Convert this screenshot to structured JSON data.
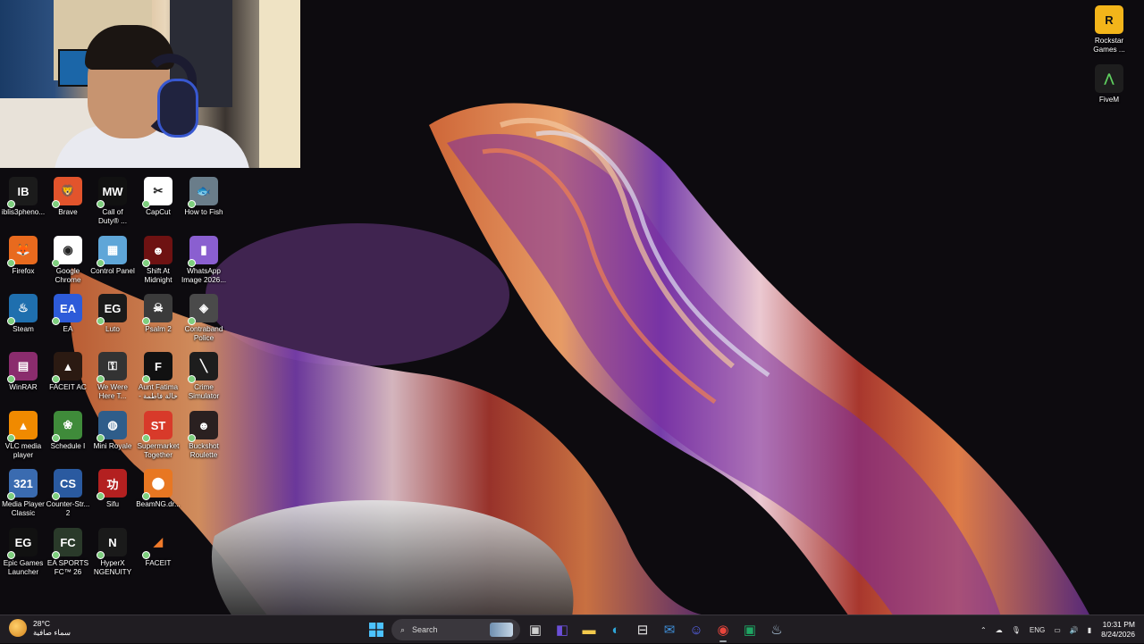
{
  "desktop": {
    "icons": [
      {
        "label": "iblis3pheno...",
        "icon": "iblis-icon",
        "color": "#1b1b1b",
        "glyph": "IB"
      },
      {
        "label": "Brave",
        "icon": "brave-icon",
        "color": "#e2542c",
        "glyph": "🦁"
      },
      {
        "label": "Call of\nDuty® ...",
        "icon": "call-of-duty-icon",
        "color": "#111111",
        "glyph": "MW"
      },
      {
        "label": "CapCut",
        "icon": "capcut-icon",
        "color": "#ffffff",
        "glyph": "✂"
      },
      {
        "label": "How to Fish",
        "icon": "how-to-fish-icon",
        "color": "#6a7d8a",
        "glyph": "🐟"
      },
      {
        "label": "Firefox",
        "icon": "firefox-icon",
        "color": "#e86a1e",
        "glyph": "🦊"
      },
      {
        "label": "Google\nChrome",
        "icon": "chrome-icon",
        "color": "#ffffff",
        "glyph": "◉"
      },
      {
        "label": "Control Panel",
        "icon": "control-panel-icon",
        "color": "#5fa6d8",
        "glyph": "▦"
      },
      {
        "label": "Shift At\nMidnight",
        "icon": "shift-at-midnight-icon",
        "color": "#6e1212",
        "glyph": "☻"
      },
      {
        "label": "WhatsApp\nImage 2026...",
        "icon": "image-file-icon",
        "color": "#8a5fd0",
        "glyph": "▮"
      },
      {
        "label": "Steam",
        "icon": "steam-icon",
        "color": "#1f6fae",
        "glyph": "♨"
      },
      {
        "label": "EA",
        "icon": "ea-icon",
        "color": "#2d5bd9",
        "glyph": "EA"
      },
      {
        "label": "Luto",
        "icon": "epic-games-icon",
        "color": "#1a1a1a",
        "glyph": "EG"
      },
      {
        "label": "Psalm 2",
        "icon": "psalm-2-icon",
        "color": "#3b3b3b",
        "glyph": "☠"
      },
      {
        "label": "Contraband\nPolice",
        "icon": "contraband-police-icon",
        "color": "#4a4a4a",
        "glyph": "◈"
      },
      {
        "label": "WinRAR",
        "icon": "winrar-icon",
        "color": "#8a2c6d",
        "glyph": "▤"
      },
      {
        "label": "FACEIT AC",
        "icon": "faceit-ac-icon",
        "color": "#2b1a12",
        "glyph": "▲"
      },
      {
        "label": "We Were\nHere T...",
        "icon": "we-were-here-icon",
        "color": "#333333",
        "glyph": "⚿"
      },
      {
        "label": "Aunt Fatima\n- خالة فاطمة",
        "icon": "aunt-fatima-icon",
        "color": "#111111",
        "glyph": "F"
      },
      {
        "label": "Crime\nSimulator",
        "icon": "crime-simulator-icon",
        "color": "#1d1d1d",
        "glyph": "╲"
      },
      {
        "label": "VLC media\nplayer",
        "icon": "vlc-icon",
        "color": "#f08a00",
        "glyph": "▲"
      },
      {
        "label": "Schedule I",
        "icon": "schedule-i-icon",
        "color": "#3f8b3a",
        "glyph": "❀"
      },
      {
        "label": "Mini Royale",
        "icon": "mini-royale-icon",
        "color": "#2f5d8a",
        "glyph": "◍"
      },
      {
        "label": "Supermarket\nTogether",
        "icon": "supermarket-together-icon",
        "color": "#d83a2a",
        "glyph": "ST"
      },
      {
        "label": "Buckshot\nRoulette",
        "icon": "buckshot-roulette-icon",
        "color": "#2a2020",
        "glyph": "☻"
      },
      {
        "label": "Media Player\nClassic",
        "icon": "media-player-classic-icon",
        "color": "#3a6bb0",
        "glyph": "321"
      },
      {
        "label": "Counter-Str...\n2",
        "icon": "counter-strike-icon",
        "color": "#2a5aa0",
        "glyph": "CS"
      },
      {
        "label": "Sifu",
        "icon": "sifu-icon",
        "color": "#b32020",
        "glyph": "功"
      },
      {
        "label": "BeamNG.dr...",
        "icon": "beamng-icon",
        "color": "#e87722",
        "glyph": "⬤"
      },
      {
        "label": "",
        "icon": "empty",
        "color": "transparent",
        "glyph": ""
      },
      {
        "label": "Epic Games\nLauncher",
        "icon": "epic-games-launcher-icon",
        "color": "#111111",
        "glyph": "EG"
      },
      {
        "label": "EA SPORTS\nFC™ 26",
        "icon": "ea-sports-fc-icon",
        "color": "#2a3a2a",
        "glyph": "FC"
      },
      {
        "label": "HyperX\nNGENUITY",
        "icon": "hyperx-ngenuity-icon",
        "color": "#1a1a1a",
        "glyph": "N"
      },
      {
        "label": "FACEIT",
        "icon": "faceit-icon",
        "color": "transparent",
        "glyph": "◢"
      }
    ],
    "right_icons": [
      {
        "label": "Rockstar\nGames ...",
        "icon": "rockstar-games-icon",
        "color": "#f3b51a",
        "glyph": "R"
      },
      {
        "label": "FiveM",
        "icon": "fivem-icon",
        "color": "#1e1e1e",
        "glyph": "⋀"
      }
    ]
  },
  "taskbar": {
    "weather": {
      "temp": "28°C",
      "condition": "سماء صافية"
    },
    "search_placeholder": "Search",
    "apps": [
      {
        "icon": "start-icon",
        "color": "#3aa0ff",
        "glyph": "⊞"
      },
      {
        "icon": "task-view-icon",
        "color": "#cfcfcf",
        "glyph": "▣"
      },
      {
        "icon": "widgets-icon",
        "color": "#6b4fd8",
        "glyph": "◧"
      },
      {
        "icon": "file-explorer-icon",
        "color": "#f2c94c",
        "glyph": "▬"
      },
      {
        "icon": "edge-icon",
        "color": "#2fa6d8",
        "glyph": "◐"
      },
      {
        "icon": "store-icon",
        "color": "#e6e6e6",
        "glyph": "⊟"
      },
      {
        "icon": "mail-icon",
        "color": "#3f8fd8",
        "glyph": "✉"
      },
      {
        "icon": "discord-icon",
        "color": "#5865f2",
        "glyph": "☺"
      },
      {
        "icon": "chrome-taskbar-icon",
        "color": "#e8453c",
        "glyph": "◉"
      },
      {
        "icon": "app-green-icon",
        "color": "#1fa463",
        "glyph": "▣"
      },
      {
        "icon": "steam-taskbar-icon",
        "color": "#b7d3ea",
        "glyph": "♨"
      }
    ],
    "tray": {
      "language": "ENG",
      "time": "10:31 PM",
      "date": "8/24/2026"
    }
  }
}
